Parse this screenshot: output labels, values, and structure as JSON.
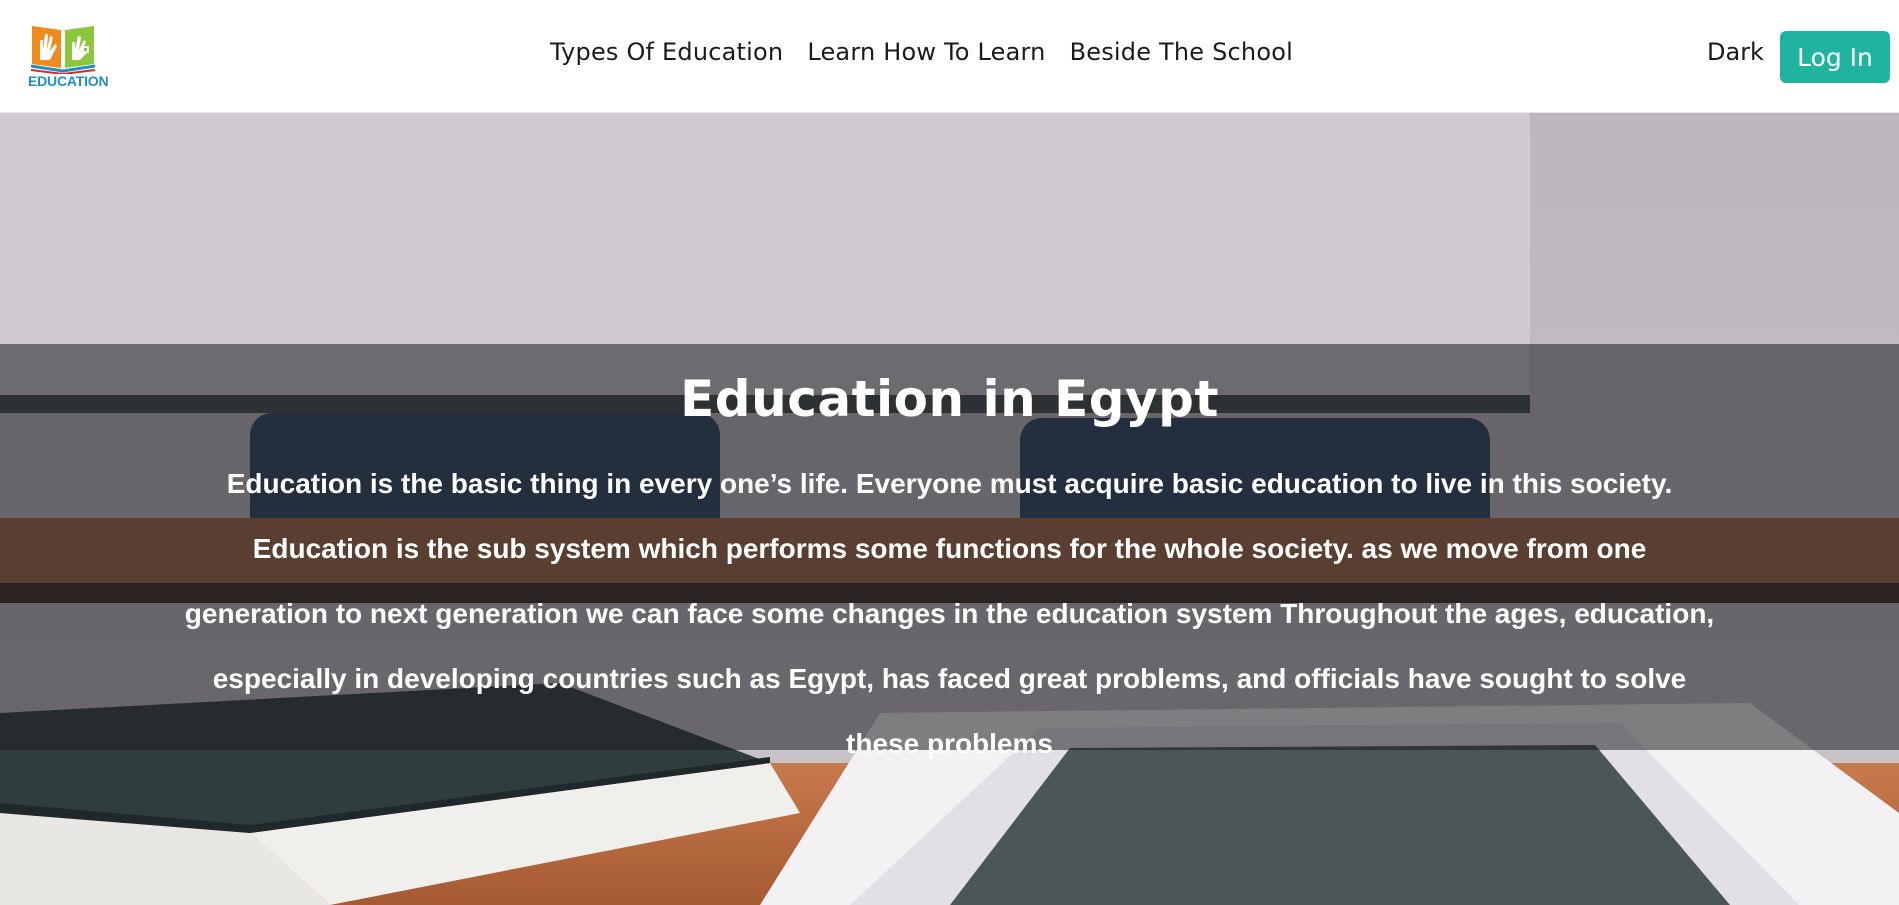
{
  "header": {
    "logo": {
      "text": "EDUCATION",
      "icon": "book-hands-logo-icon"
    },
    "nav": [
      {
        "label": "Types Of Education"
      },
      {
        "label": "Learn How To Learn"
      },
      {
        "label": "Beside The School"
      }
    ],
    "theme_toggle_label": "Dark",
    "login_label": "Log In"
  },
  "hero": {
    "title": "Education in Egypt",
    "paragraph": "Education is the basic thing in every one’s life. Everyone must acquire basic education to live in this society. Education is the sub system which performs some functions for the whole society. as we move from one generation to next generation we can face some changes in the education system Throughout the ages, education, especially in developing countries such as Egypt, has faced great problems, and officials have sought to solve these problems",
    "background": "classroom-desk-books-tablet-photo"
  },
  "colors": {
    "accent": "#20b4a0",
    "logo_blue": "#1f8fc4",
    "logo_orange": "#f08a1c",
    "logo_green": "#8cc63f"
  }
}
